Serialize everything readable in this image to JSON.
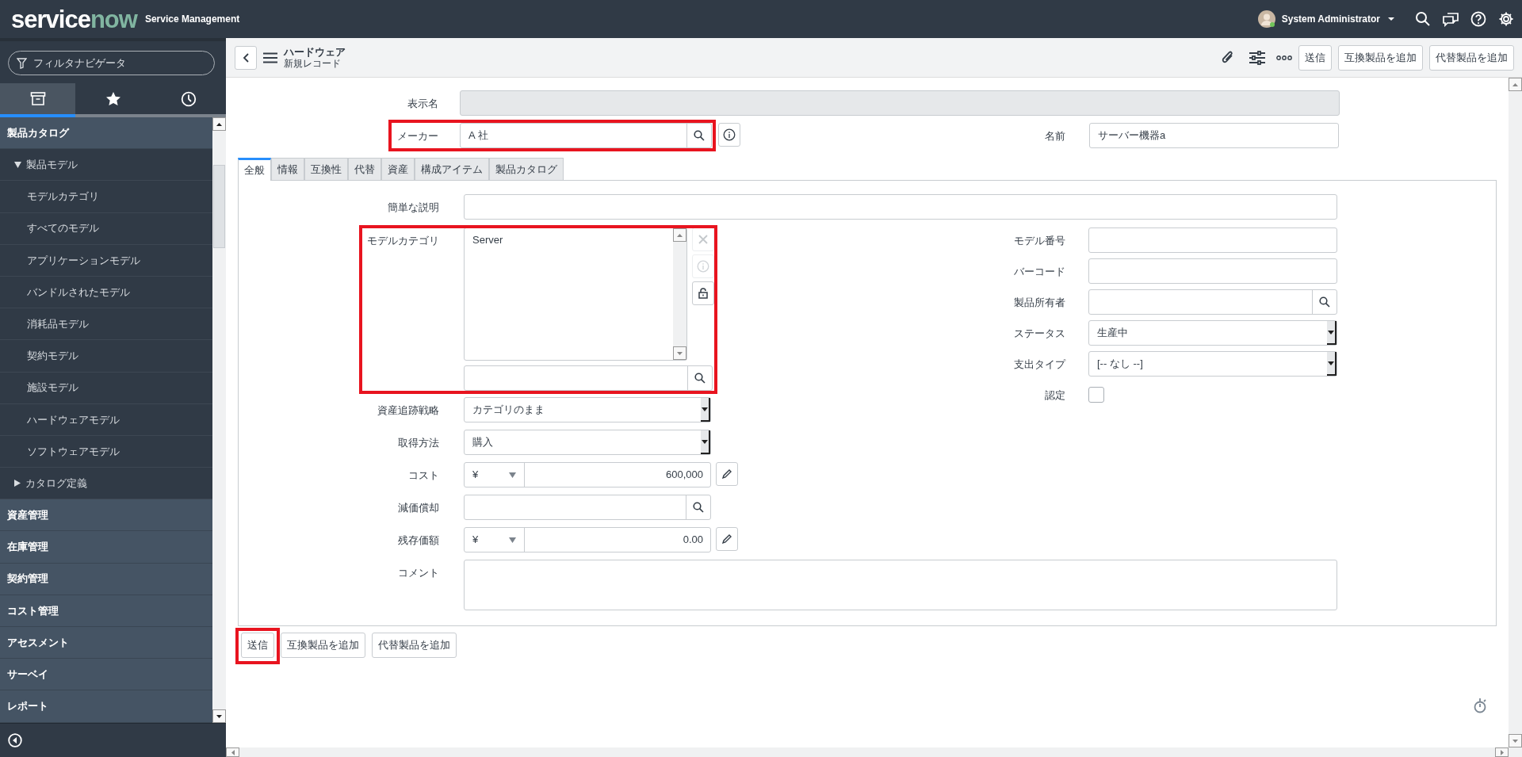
{
  "app": {
    "logo_prefix": "service",
    "logo_suffix": "now",
    "product": "Service Management"
  },
  "user": {
    "name": "System Administrator"
  },
  "nav": {
    "filter_placeholder": "フィルタナビゲータ",
    "tabs": [
      {
        "kind": "modules",
        "selected": true
      },
      {
        "kind": "favorites",
        "selected": false
      },
      {
        "kind": "history",
        "selected": false
      }
    ],
    "sections": [
      {
        "label": "製品カタログ",
        "children": [
          {
            "label": "製品モデル",
            "expanded": true,
            "children": [
              {
                "label": "モデルカテゴリ"
              },
              {
                "label": "すべてのモデル"
              },
              {
                "label": "アプリケーションモデル"
              },
              {
                "label": "バンドルされたモデル"
              },
              {
                "label": "消耗品モデル"
              },
              {
                "label": "契約モデル"
              },
              {
                "label": "施設モデル"
              },
              {
                "label": "ハードウェアモデル"
              },
              {
                "label": "ソフトウェアモデル"
              }
            ]
          },
          {
            "label": "カタログ定義",
            "expanded": false
          }
        ]
      },
      {
        "label": "資産管理"
      },
      {
        "label": "在庫管理"
      },
      {
        "label": "契約管理"
      },
      {
        "label": "コスト管理"
      },
      {
        "label": "アセスメント"
      },
      {
        "label": "サーベイ"
      },
      {
        "label": "レポート"
      }
    ]
  },
  "record": {
    "table": "ハードウェア",
    "subtitle": "新規レコード"
  },
  "header_buttons": [
    "送信",
    "互換製品を追加",
    "代替製品を追加"
  ],
  "top_fields": [
    {
      "label": "表示名",
      "kind": "readonly",
      "highlighted": false
    },
    {
      "label": "メーカー",
      "kind": "reference",
      "value": "A 社",
      "highlighted": true
    },
    {
      "label": "名前",
      "kind": "text",
      "value": "サーバー機器a",
      "highlighted": false
    }
  ],
  "tabs": [
    {
      "label": "全般",
      "selected": true
    },
    {
      "label": "情報",
      "selected": false
    },
    {
      "label": "互換性",
      "selected": false
    },
    {
      "label": "代替",
      "selected": false
    },
    {
      "label": "資産",
      "selected": false
    },
    {
      "label": "構成アイテム",
      "selected": false
    },
    {
      "label": "製品カタログ",
      "selected": false
    }
  ],
  "general": {
    "short_description": {
      "label": "簡単な説明",
      "kind": "text"
    },
    "left_fields": [
      {
        "label": "モデルカテゴリ",
        "kind": "list",
        "items": [
          "Server"
        ],
        "highlighted": true
      },
      {
        "label": "資産追跡戦略",
        "kind": "select",
        "value": "カテゴリのまま"
      },
      {
        "label": "取得方法",
        "kind": "select",
        "value": "購入"
      },
      {
        "label": "コスト",
        "kind": "currency",
        "currency": "¥",
        "value": "600,000"
      },
      {
        "label": "減価償却",
        "kind": "reference"
      },
      {
        "label": "残存価額",
        "kind": "currency",
        "currency": "¥",
        "value": "0.00"
      }
    ],
    "right_fields": [
      {
        "label": "モデル番号",
        "kind": "text"
      },
      {
        "label": "バーコード",
        "kind": "text"
      },
      {
        "label": "製品所有者",
        "kind": "reference"
      },
      {
        "label": "ステータス",
        "kind": "select",
        "value": "生産中"
      },
      {
        "label": "支出タイプ",
        "kind": "select",
        "value": "[-- なし --]"
      },
      {
        "label": "認定",
        "kind": "checkbox",
        "checked": false
      }
    ],
    "comment": {
      "label": "コメント",
      "kind": "textarea"
    }
  },
  "footer_buttons": [
    {
      "label": "送信",
      "highlighted": true
    },
    {
      "label": "互換製品を追加",
      "highlighted": false
    },
    {
      "label": "代替製品を追加",
      "highlighted": false
    }
  ]
}
